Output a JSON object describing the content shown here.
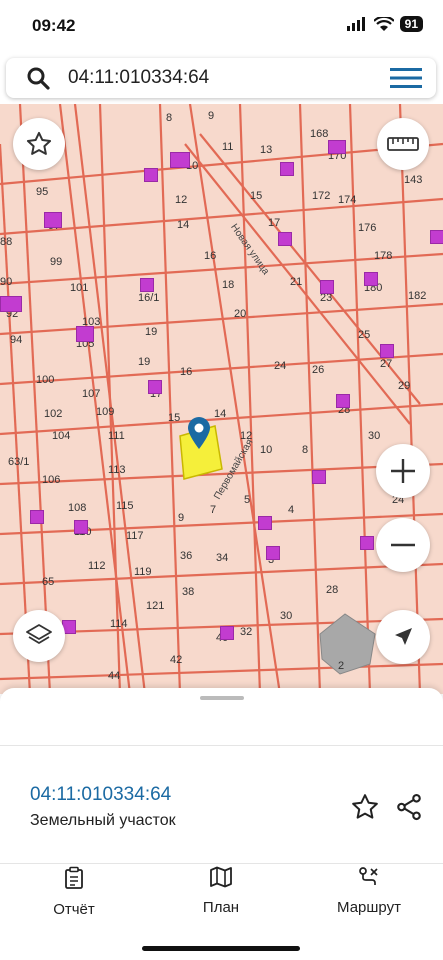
{
  "status_bar": {
    "time": "09:42",
    "battery": "91"
  },
  "search": {
    "query": "04:11:010334:64"
  },
  "map": {
    "plot_labels": [
      "8",
      "9",
      "11",
      "13",
      "168",
      "170",
      "143",
      "95",
      "97",
      "10",
      "12",
      "14",
      "15",
      "17",
      "172",
      "174",
      "88",
      "99",
      "16",
      "176",
      "178",
      "90",
      "101",
      "16/1",
      "18",
      "19",
      "21",
      "23",
      "180",
      "182",
      "92",
      "103",
      "20",
      "25",
      "94",
      "105",
      "19",
      "16",
      "24",
      "26",
      "27",
      "29",
      "100",
      "107",
      "17",
      "28",
      "102",
      "109",
      "15",
      "14",
      "12",
      "10",
      "8",
      "30",
      "104",
      "111",
      "63/1",
      "113",
      "106",
      "6",
      "24",
      "108",
      "115",
      "117",
      "9",
      "7",
      "5",
      "4",
      "110",
      "36",
      "34",
      "3",
      "112",
      "119",
      "38",
      "65",
      "121",
      "114",
      "40",
      "32",
      "30",
      "28",
      "42",
      "2",
      "44"
    ],
    "road_labels": [
      "Новая улица",
      "Первомайская"
    ],
    "parcel_color": "#f7d9cc",
    "border_color": "#e26a55",
    "selected_color": "#f5ef3a"
  },
  "sheet": {
    "cadastral_number": "04:11:010334:64",
    "parcel_type": "Земельный участок",
    "nav": [
      {
        "label": "Отчёт"
      },
      {
        "label": "План"
      },
      {
        "label": "Маршрут"
      }
    ]
  }
}
